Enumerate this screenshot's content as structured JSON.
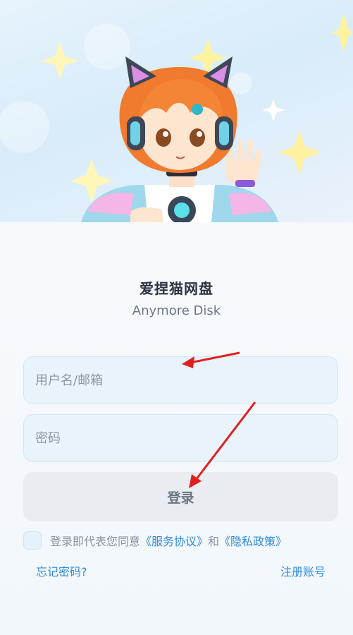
{
  "app": {
    "name": "爱捏猫网盘",
    "subtitle": "Anymore Disk"
  },
  "form": {
    "username_placeholder": "用户名/邮箱",
    "password_placeholder": "密码",
    "login_label": "登录"
  },
  "agreement": {
    "prefix": "登录即代表您同意",
    "service_link": "《服务协议》",
    "conjunction": "和",
    "privacy_link": "《隐私政策》"
  },
  "links": {
    "forgot_password": "忘记密码?",
    "register": "注册账号"
  },
  "colors": {
    "accent": "#2f8be0",
    "annotation_arrow": "#e0201e"
  },
  "hero": {
    "illustration": "cat-ear-headphone-anime-girl-waving",
    "decorations": [
      "sparkle-icon",
      "bubble-icon"
    ]
  }
}
